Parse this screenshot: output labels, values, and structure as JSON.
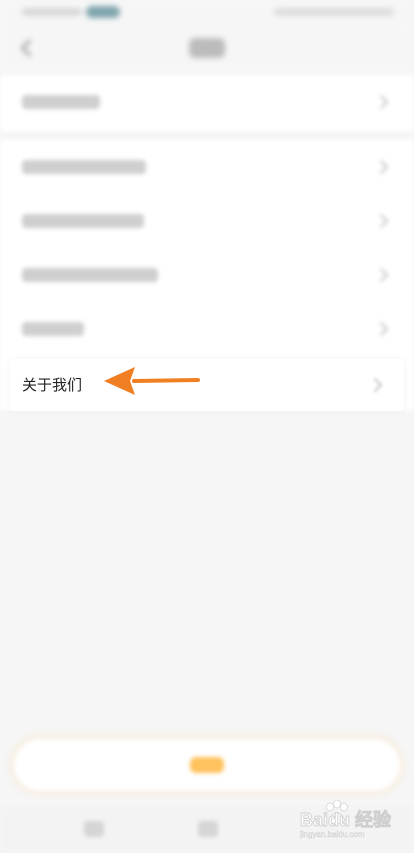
{
  "about_row": {
    "label": "关于我们"
  },
  "colors": {
    "accent": "#FFB84D",
    "arrow": "#F07E22"
  },
  "icons": {
    "back": "chevron-left-icon",
    "chevron": "chevron-right-icon",
    "annotation": "arrow-left-icon",
    "watermark": "baidu-jingyan-logo"
  },
  "watermark": {
    "text": "Baidu 经验",
    "subtext": "jingyan.baidu.com"
  }
}
